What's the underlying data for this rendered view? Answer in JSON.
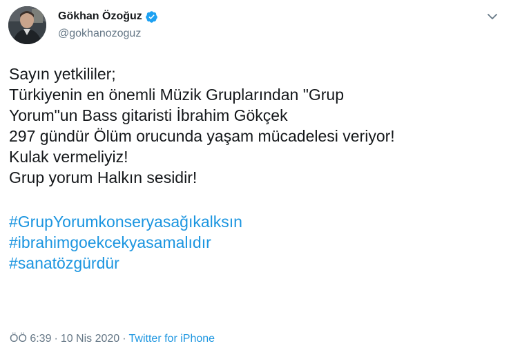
{
  "author": {
    "display_name": "Gökhan Özoğuz",
    "handle": "@gokhanozoguz",
    "verified": true
  },
  "icons": {
    "verified": "verified-badge-icon",
    "menu": "chevron-down-icon"
  },
  "colors": {
    "link": "#1b95e0",
    "text": "#14171a",
    "muted": "#657786",
    "verified": "#1da1f2"
  },
  "tweet": {
    "lines": [
      "Sayın yetkililer;",
      "Türkiyenin en önemli Müzik Gruplarından \"Grup",
      "Yorum\"un Bass gitaristi İbrahim Gökçek",
      "297 gündür Ölüm orucunda yaşam mücadelesi veriyor!",
      "Kulak vermeliyiz!",
      "Grup yorum Halkın sesidir!"
    ],
    "hashtags": [
      "#GrupYorumkonseryasağıkalksın",
      "#ibrahimgoekcekyasamalıdır",
      "#sanatözgürdür"
    ]
  },
  "meta": {
    "time": "ÖÖ 6:39",
    "separator": "·",
    "date": "10 Nis 2020",
    "source": "Twitter for iPhone"
  }
}
